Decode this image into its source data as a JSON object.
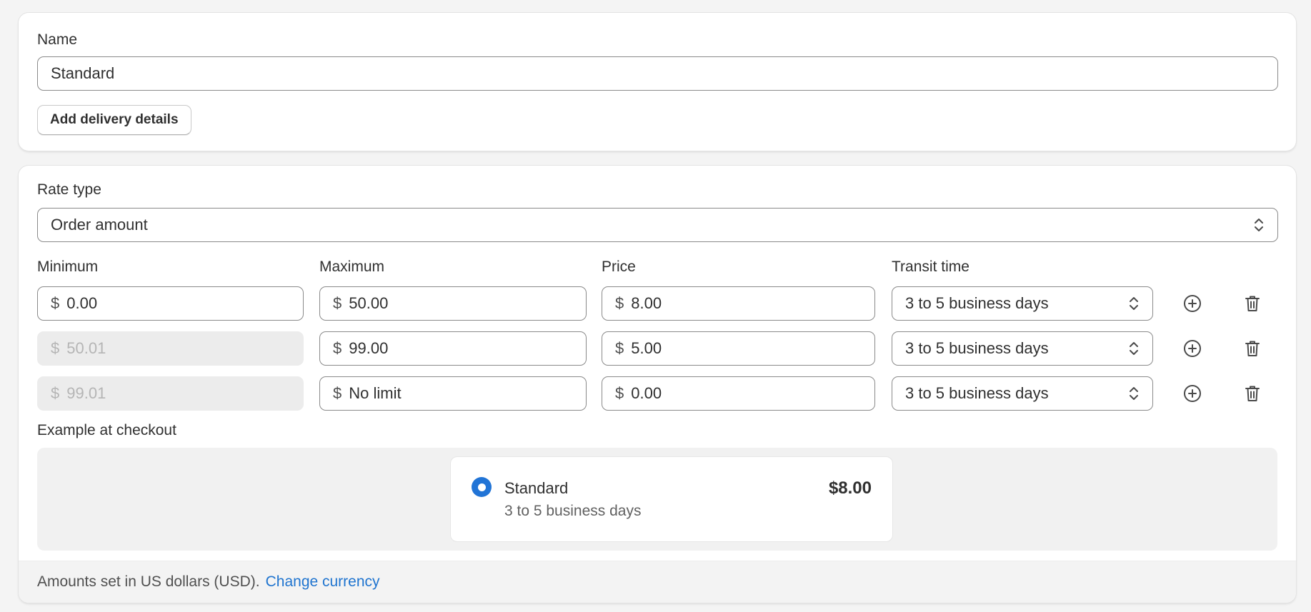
{
  "name_section": {
    "label": "Name",
    "value": "Standard",
    "add_details_button": "Add delivery details"
  },
  "rate_section": {
    "rate_type_label": "Rate type",
    "rate_type_value": "Order amount",
    "columns": {
      "minimum": "Minimum",
      "maximum": "Maximum",
      "price": "Price",
      "transit": "Transit time"
    },
    "currency_symbol": "$",
    "rows": [
      {
        "min": "0.00",
        "max": "50.00",
        "price": "8.00",
        "transit": "3 to 5 business days"
      },
      {
        "min": "50.01",
        "max": "99.00",
        "price": "5.00",
        "transit": "3 to 5 business days"
      },
      {
        "min": "99.01",
        "max": "No limit",
        "price": "0.00",
        "transit": "3 to 5 business days"
      }
    ],
    "example_label": "Example at checkout",
    "example": {
      "name": "Standard",
      "transit": "3 to 5 business days",
      "price": "$8.00"
    },
    "footer_text": "Amounts set in US dollars (USD).",
    "footer_link": "Change currency"
  },
  "colors": {
    "accent": "#2174d6",
    "link": "#1f74cf",
    "disabled_bg": "#ececec"
  }
}
